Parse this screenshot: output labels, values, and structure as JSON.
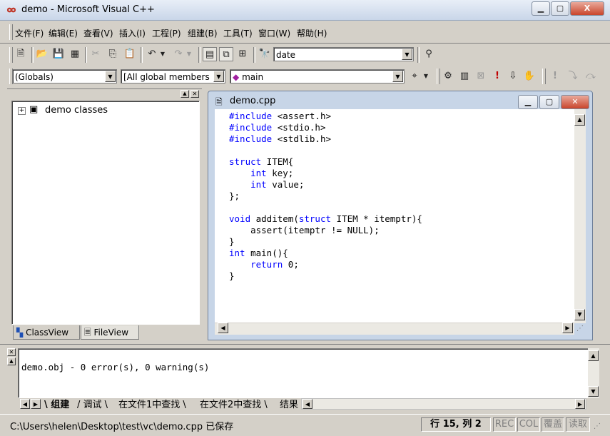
{
  "window": {
    "title": "demo - Microsoft Visual C++",
    "minimize_label": "▁",
    "maximize_label": "▢",
    "close_label": "X"
  },
  "menu": [
    "文件(F)",
    "编辑(E)",
    "查看(V)",
    "插入(I)",
    "工程(P)",
    "组建(B)",
    "工具(T)",
    "窗口(W)",
    "帮助(H)"
  ],
  "toolbar": {
    "find_value": "date"
  },
  "wizardbar": {
    "class_value": "(Globals)",
    "filter_value": "[All global members",
    "member_value": "main"
  },
  "workspace": {
    "tree_root": "demo classes",
    "tabs": [
      "ClassView",
      "FileView"
    ]
  },
  "editor": {
    "title": "demo.cpp",
    "lines": [
      "#include <assert.h>",
      "#include <stdio.h>",
      "#include <stdlib.h>",
      "",
      "struct ITEM{",
      "    int key;",
      "    int value;",
      "};",
      "",
      "void additem(struct ITEM * itemptr){",
      "    assert(itemptr != NULL);",
      "}",
      "int main(){",
      "    return 0;",
      "}"
    ]
  },
  "output": {
    "text": "demo.obj - 0 error(s), 0 warning(s)",
    "tabs": [
      "组建",
      "调试",
      "在文件1中查找",
      "在文件2中查找",
      "结果"
    ]
  },
  "status": {
    "message": "C:\\Users\\helen\\Desktop\\test\\vc\\demo.cpp 已保存",
    "position": "行 15, 列 2",
    "rec": "REC",
    "col": "COL",
    "ovr": "覆盖",
    "read": "读取"
  }
}
